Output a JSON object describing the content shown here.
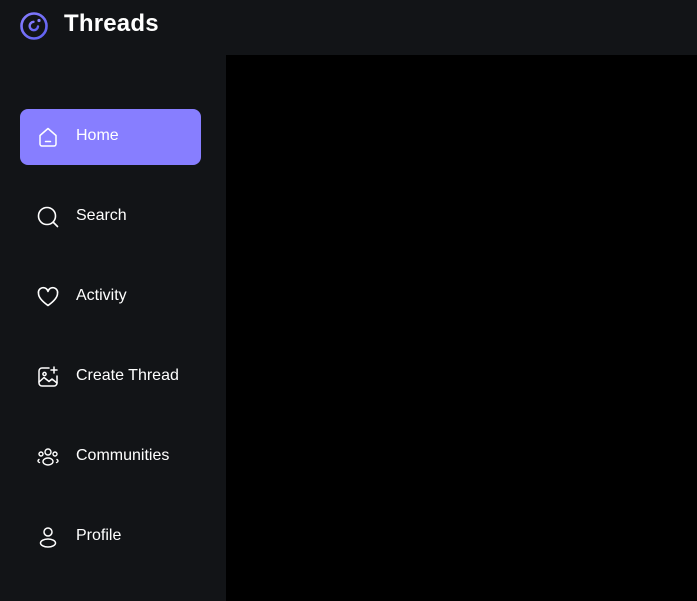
{
  "app": {
    "title": "Threads",
    "logo_icon": "threads-logo-icon",
    "accent_color": "#877EFF"
  },
  "sidebar": {
    "items": [
      {
        "label": "Home",
        "icon": "home-icon",
        "active": true
      },
      {
        "label": "Search",
        "icon": "search-icon",
        "active": false
      },
      {
        "label": "Activity",
        "icon": "heart-icon",
        "active": false
      },
      {
        "label": "Create Thread",
        "icon": "create-image-icon",
        "active": false
      },
      {
        "label": "Communities",
        "icon": "communities-icon",
        "active": false
      },
      {
        "label": "Profile",
        "icon": "user-icon",
        "active": false
      }
    ]
  }
}
